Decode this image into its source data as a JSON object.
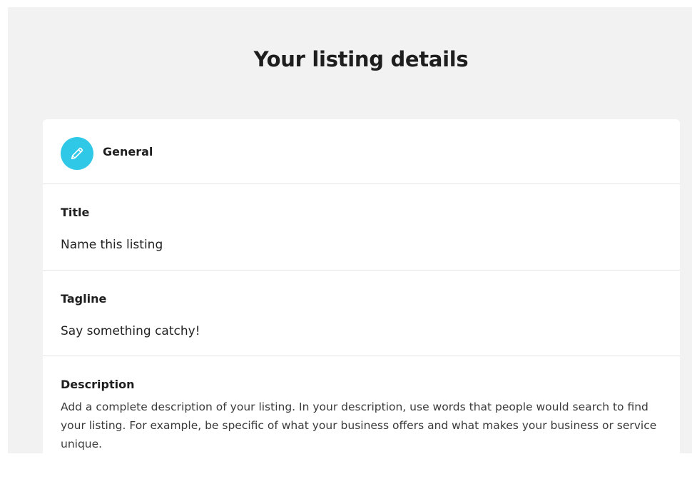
{
  "page": {
    "title": "Your listing details"
  },
  "sections": {
    "general": {
      "label": "General",
      "icon": "pencil-icon",
      "icon_bg": "#2fc8e6"
    },
    "title": {
      "label": "Title",
      "placeholder": "Name this listing",
      "value": ""
    },
    "tagline": {
      "label": "Tagline",
      "placeholder": "Say something catchy!",
      "value": ""
    },
    "description": {
      "label": "Description",
      "help": "Add a complete description of your listing. In your description, use words that people would search to find your listing. For example, be specific of what your business offers and what makes your business or service unique."
    }
  }
}
